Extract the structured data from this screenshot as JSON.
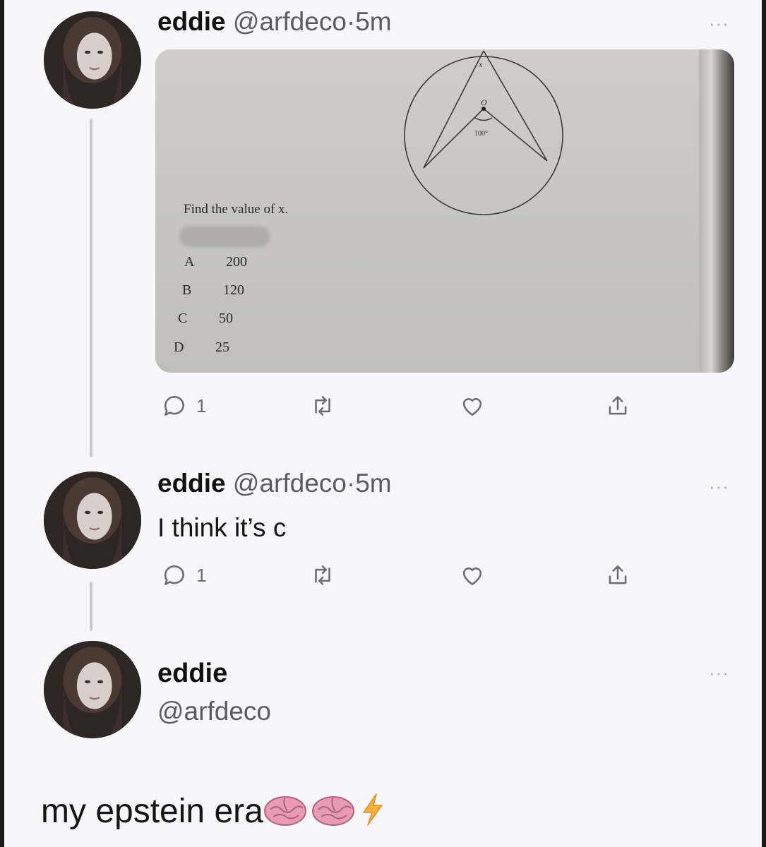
{
  "tweets": [
    {
      "name": "eddie",
      "handle": "@arfdeco",
      "separator": "·",
      "time": "5m",
      "more": "···",
      "image": {
        "question": "Find the value of x.",
        "diagram_labels": {
          "angle_x": "x",
          "center": "O",
          "angle": "100°"
        },
        "options": [
          {
            "letter": "A",
            "value": "200"
          },
          {
            "letter": "B",
            "value": "120"
          },
          {
            "letter": "C",
            "value": "50"
          },
          {
            "letter": "D",
            "value": "25"
          }
        ]
      },
      "actions": {
        "reply_count": "1",
        "icons": [
          "reply-icon",
          "retweet-icon",
          "like-icon",
          "share-icon"
        ]
      }
    },
    {
      "name": "eddie",
      "handle": "@arfdeco",
      "separator": "·",
      "time": "5m",
      "more": "···",
      "text": "I think it’s c",
      "actions": {
        "reply_count": "1",
        "icons": [
          "reply-icon",
          "retweet-icon",
          "like-icon",
          "share-icon"
        ]
      }
    }
  ],
  "detail": {
    "name": "eddie",
    "handle": "@arfdeco",
    "more": "···",
    "text": "my epstein era",
    "emojis": [
      "brain-emoji",
      "brain-emoji",
      "lightning-emoji"
    ]
  },
  "colors": {
    "background": "#f7f6f9",
    "thread_line": "#c9c7cd",
    "muted_text": "#5b5b60",
    "brain": "#e89bb5",
    "lightning": "#f2b33d"
  }
}
